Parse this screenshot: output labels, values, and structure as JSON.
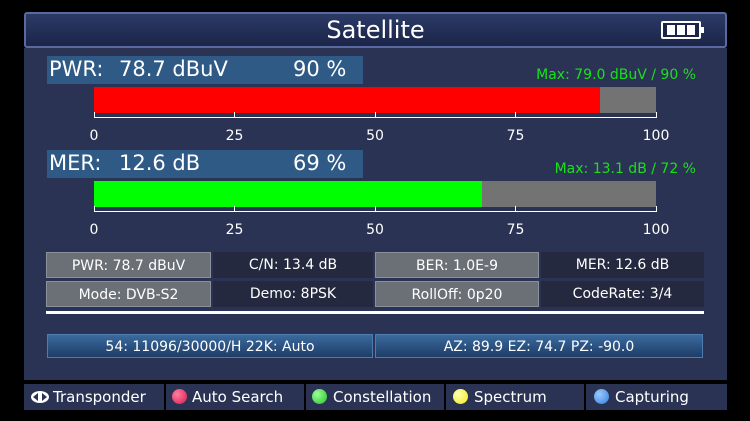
{
  "title": "Satellite",
  "battery_icon": "battery-icon",
  "pwr": {
    "name": "PWR:",
    "value": "78.7 dBuV",
    "percent_text": "90 %",
    "percent": 90,
    "max": "Max: 79.0 dBuV / 90 %",
    "color": "#ff0000"
  },
  "mer": {
    "name": "MER:",
    "value": "12.6 dB",
    "percent_text": "69 %",
    "percent": 69,
    "max": "Max: 13.1 dB  / 72 %",
    "color": "#00ff00"
  },
  "scale": {
    "ticks": [
      "0",
      "25",
      "50",
      "75",
      "100"
    ]
  },
  "stats": {
    "row1": [
      "PWR: 78.7 dBuV",
      "C/N: 13.4 dB",
      "BER: 1.0E-9",
      "MER: 12.6 dB"
    ],
    "row2": [
      "Mode: DVB-S2",
      "Demo: 8PSK",
      "RollOff: 0p20",
      "CodeRate: 3/4"
    ]
  },
  "transponder_info": "54: 11096/30000/H 22K: Auto",
  "antenna_info": "AZ: 89.9  EZ: 74.7  PZ: -90.0",
  "footer": {
    "transponder": "Transponder",
    "auto_search": "Auto Search",
    "constellation": "Constellation",
    "spectrum": "Spectrum",
    "capturing": "Capturing"
  },
  "colors": {
    "red_key": "#d61a4b",
    "green_key": "#21c321",
    "yellow_key": "#f2ea18",
    "blue_key": "#2f7fe0"
  }
}
